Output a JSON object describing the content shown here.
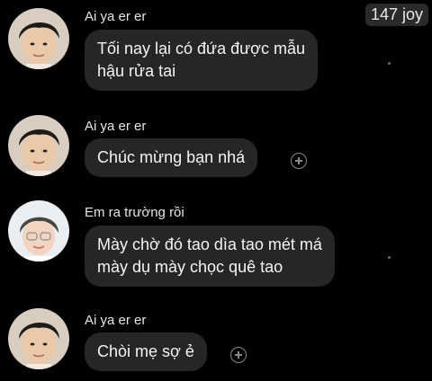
{
  "overlay_label": "147 joy",
  "messages": [
    {
      "sender": "Ai ya er er",
      "avatar": "young-man-photo",
      "lines": [
        "Tối nay lại có đứa được mẫu",
        "hậu rửa tai"
      ],
      "reaction_icon": "add-reaction-icon"
    },
    {
      "sender": "Ai ya er er",
      "avatar": "young-man-photo",
      "lines": [
        "Chúc mừng bạn nhá"
      ],
      "reaction_icon": "add-reaction-icon"
    },
    {
      "sender": "Em ra trường rồi",
      "avatar": "person-photo",
      "lines": [
        "Mày chờ đó tao dìa tao mét má",
        "mày dụ mày chọc quê tao"
      ],
      "reaction_icon": "add-reaction-icon"
    },
    {
      "sender": "Ai ya er er",
      "avatar": "young-man-photo",
      "lines": [
        "Chòi mẹ sợ ẻ"
      ],
      "reaction_icon": "add-reaction-icon"
    }
  ]
}
